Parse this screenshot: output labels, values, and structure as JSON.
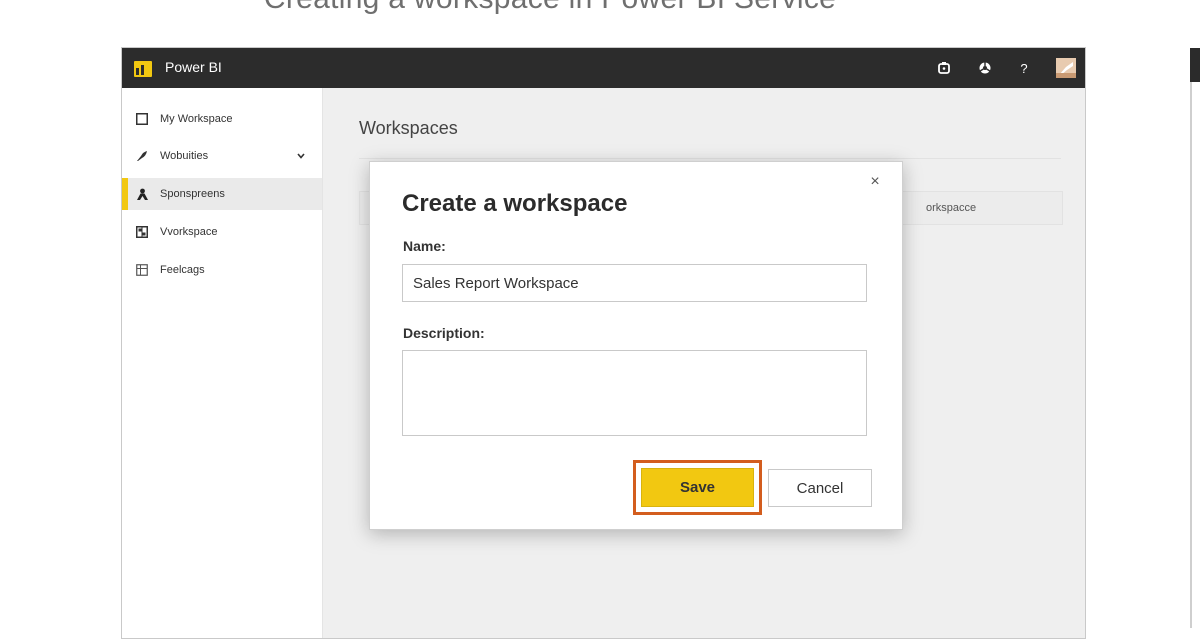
{
  "heading": "Creating a workspace in Power BI Service",
  "app": {
    "title": "Power BI",
    "brand_color": "#f2c811",
    "topbar_color": "#2c2c2c",
    "topbar_icons": [
      "notification-icon",
      "settings-icon",
      "help-icon",
      "user-avatar"
    ],
    "help_glyph": "?"
  },
  "sidebar": {
    "items": [
      {
        "label": "My Workspace",
        "icon": "square-icon"
      },
      {
        "label": "Wobuities",
        "icon": "leaf-icon",
        "expandable": true
      },
      {
        "label": "Sponspreens",
        "icon": "person-icon",
        "active": true
      },
      {
        "label": "Vvorkspace",
        "icon": "grid-icon"
      },
      {
        "label": "Feelcags",
        "icon": "table-icon"
      }
    ]
  },
  "main": {
    "title": "Workspaces",
    "card_label": "orkspacce"
  },
  "dialog": {
    "title": "Create a workspace",
    "close_glyph": "×",
    "name_label": "Name:",
    "name_value": "Sales Report Workspace",
    "description_label": "Description:",
    "description_value": "",
    "save_label": "Save",
    "cancel_label": "Cancel",
    "highlight_color": "#d35d1e"
  }
}
